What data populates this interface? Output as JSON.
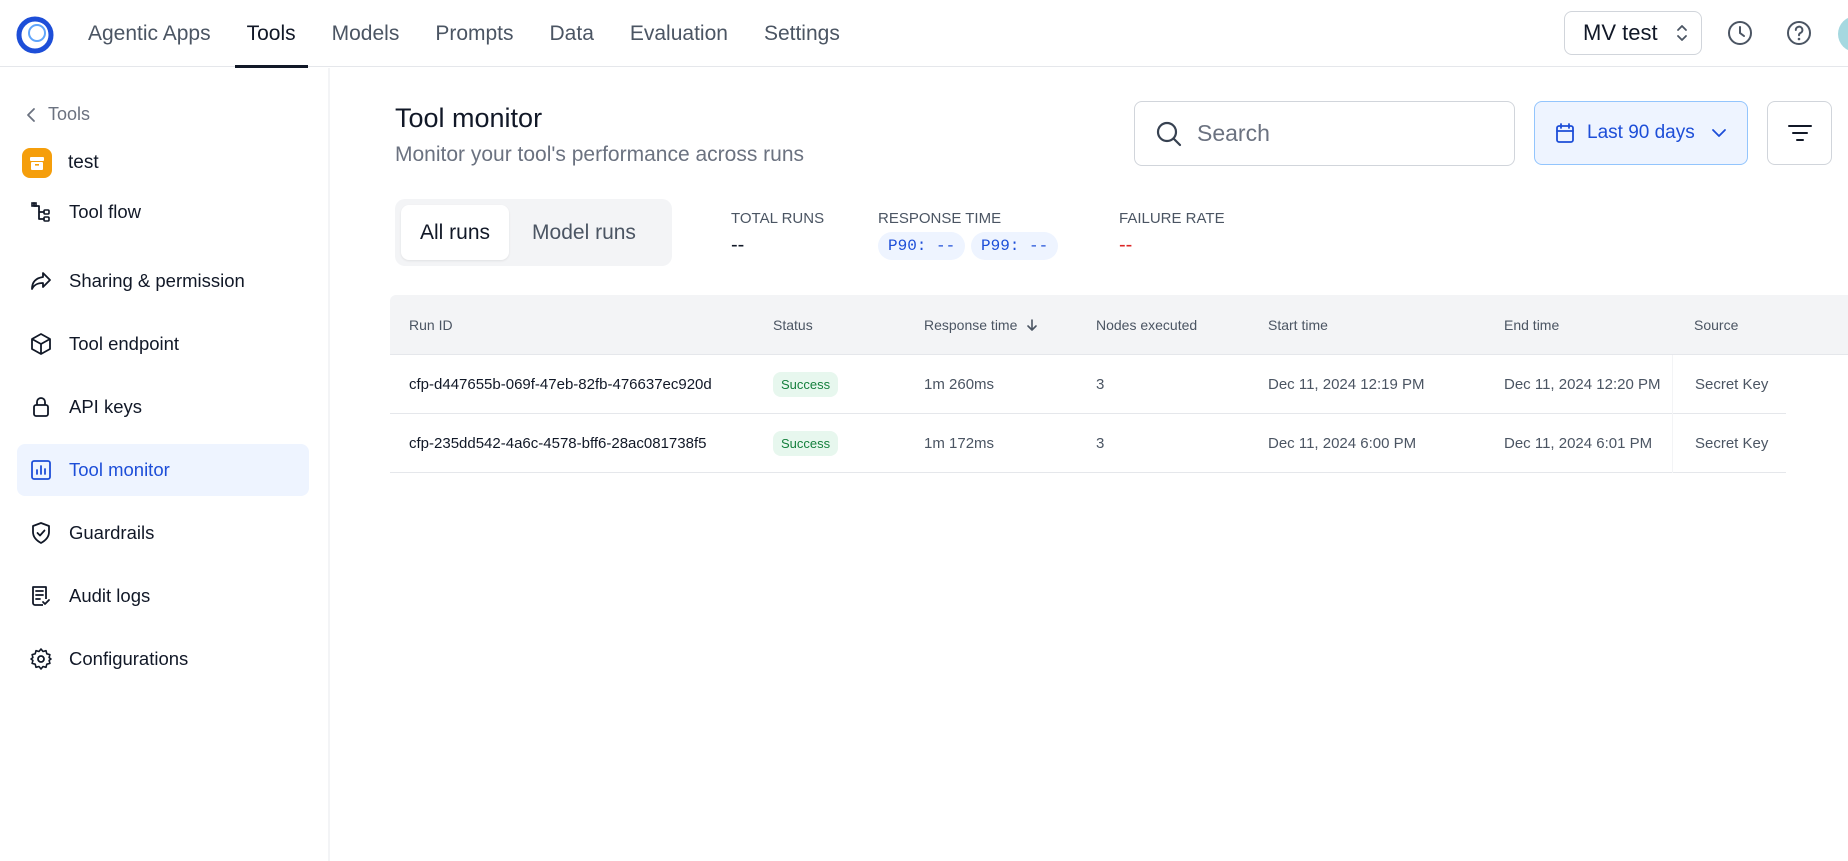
{
  "topbar": {
    "nav": [
      {
        "label": "Agentic Apps",
        "active": false
      },
      {
        "label": "Tools",
        "active": true
      },
      {
        "label": "Models",
        "active": false
      },
      {
        "label": "Prompts",
        "active": false
      },
      {
        "label": "Data",
        "active": false
      },
      {
        "label": "Evaluation",
        "active": false
      },
      {
        "label": "Settings",
        "active": false
      }
    ],
    "org_select": "MV test",
    "icons": [
      "history-icon",
      "help-icon"
    ]
  },
  "sidebar": {
    "back_label": "Tools",
    "tool_name": "test",
    "items": [
      {
        "label": "Tool flow",
        "icon": "tool-flow-icon",
        "active": false
      },
      {
        "label": "Sharing & permission",
        "icon": "share-icon",
        "active": false
      },
      {
        "label": "Tool endpoint",
        "icon": "cube-icon",
        "active": false
      },
      {
        "label": "API keys",
        "icon": "lock-icon",
        "active": false
      },
      {
        "label": "Tool monitor",
        "icon": "chart-icon",
        "active": true
      },
      {
        "label": "Guardrails",
        "icon": "shield-icon",
        "active": false
      },
      {
        "label": "Audit logs",
        "icon": "log-icon",
        "active": false
      },
      {
        "label": "Configurations",
        "icon": "gear-icon",
        "active": false
      }
    ]
  },
  "main": {
    "title": "Tool monitor",
    "subtitle": "Monitor your tool's performance across runs",
    "search_placeholder": "Search",
    "date_range": "Last 90 days",
    "tabs": [
      {
        "label": "All runs",
        "active": true
      },
      {
        "label": "Model runs",
        "active": false
      }
    ],
    "metrics": {
      "total_runs": {
        "label": "TOTAL RUNS",
        "value": "--"
      },
      "response_time": {
        "label": "RESPONSE TIME",
        "p90": "P90: --",
        "p99": "P99: --"
      },
      "failure_rate": {
        "label": "FAILURE RATE",
        "value": "--"
      }
    },
    "colors": {
      "accent": "#1d4ed8",
      "success": "#15803d",
      "failure": "#dc2626"
    },
    "table": {
      "columns": [
        "Run ID",
        "Status",
        "Response time",
        "Nodes executed",
        "Start time",
        "End time",
        "Source"
      ],
      "rows": [
        [
          "cfp-d447655b-069f-47eb-82fb-476637ec920d",
          "Success",
          "1m 260ms",
          "3",
          "Dec 11, 2024 12:19 PM",
          "Dec 11, 2024 12:20 PM",
          "Secret Key"
        ],
        [
          "cfp-235dd542-4a6c-4578-bff6-28ac081738f5",
          "Success",
          "1m 172ms",
          "3",
          "Dec 11, 2024 6:00 PM",
          "Dec 11, 2024 6:01 PM",
          "Secret Key"
        ]
      ]
    }
  }
}
